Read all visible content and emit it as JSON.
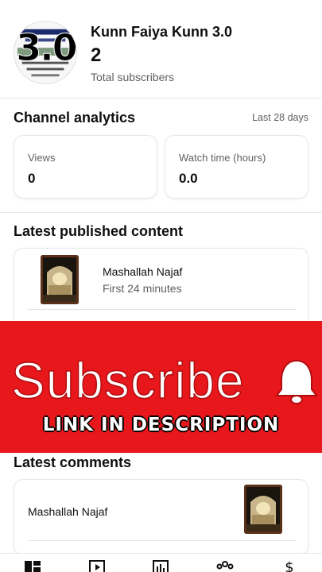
{
  "channel": {
    "name": "Kunn Faiya Kunn 3.0",
    "subscriber_count": "2",
    "subscriber_label": "Total subscribers",
    "avatar_text": "3.0"
  },
  "analytics": {
    "title": "Channel analytics",
    "period": "Last 28 days",
    "metrics": [
      {
        "label": "Views",
        "value": "0"
      },
      {
        "label": "Watch time (hours)",
        "value": "0.0"
      }
    ]
  },
  "latest_content": {
    "title": "Latest published content",
    "items": [
      {
        "title": "Mashallah Najaf",
        "subtitle": "First 24 minutes"
      }
    ]
  },
  "overlay": {
    "subscribe_text": "Subscribe",
    "link_text": "LINK IN DESCRIPTION",
    "bg_color": "#e8171c"
  },
  "comments": {
    "title": "Latest comments",
    "items": [
      {
        "video_title": "Mashallah Najaf"
      }
    ]
  },
  "bottom_nav": {
    "icons": [
      "dashboard-icon",
      "content-icon",
      "analytics-icon",
      "community-icon",
      "earn-icon"
    ]
  }
}
